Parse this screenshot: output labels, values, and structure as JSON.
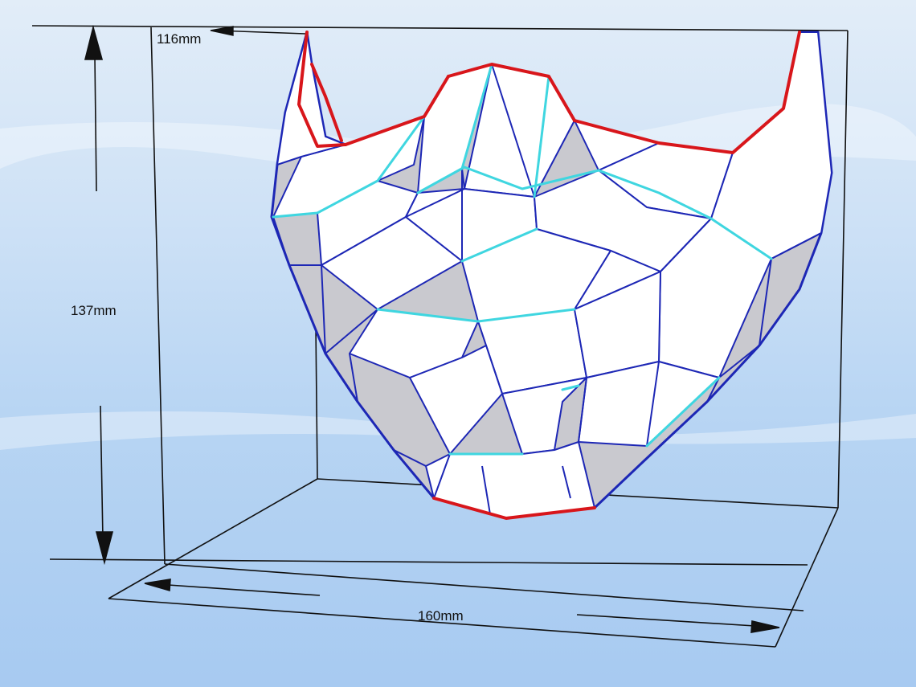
{
  "dimensions": {
    "depth_label": "116mm",
    "height_label": "137mm",
    "width_label": "160mm"
  },
  "colors": {
    "primary_edge": "#1d27b5",
    "cut_edge": "#d8161b",
    "valley_edge": "#3fd6e0",
    "face_light": "#ffffff",
    "face_shade": "#c9c9cf",
    "frame_line": "#111111"
  }
}
